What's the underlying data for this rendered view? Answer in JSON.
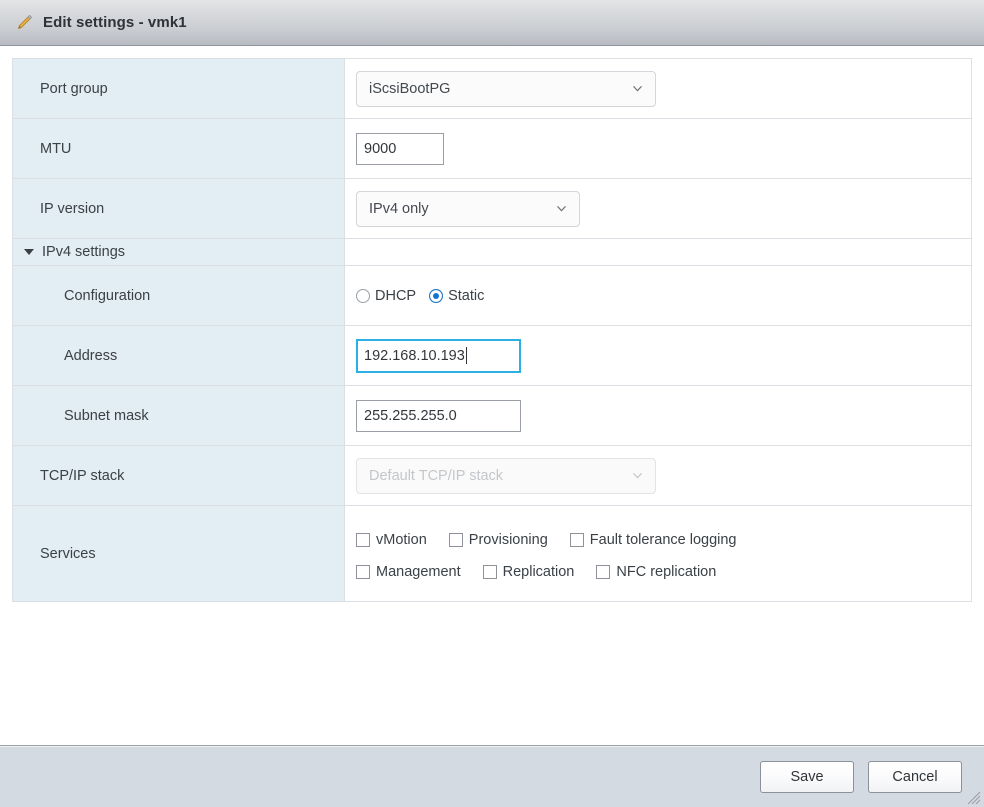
{
  "window": {
    "title": "Edit settings - vmk1",
    "icon": "pencil-icon"
  },
  "form": {
    "rows": [
      {
        "label": "Port group",
        "control": "select",
        "value": "iScsiBootPG"
      },
      {
        "label": "MTU",
        "control": "text",
        "value": "9000"
      },
      {
        "label": "IP version",
        "control": "select",
        "value": "IPv4 only"
      },
      {
        "label": "IPv4 settings",
        "control": "section",
        "expanded": true
      },
      {
        "label": "Configuration",
        "control": "radio"
      },
      {
        "label": "Address",
        "control": "text",
        "value": "192.168.10.193",
        "focused": true
      },
      {
        "label": "Subnet mask",
        "control": "text",
        "value": "255.255.255.0"
      },
      {
        "label": "TCP/IP stack",
        "control": "select",
        "value": "Default TCP/IP stack",
        "disabled": true
      },
      {
        "label": "Services",
        "control": "checkboxes"
      }
    ],
    "labels": {
      "port_group": "Port group",
      "mtu": "MTU",
      "ip_version": "IP version",
      "ipv4_settings": "IPv4 settings",
      "configuration": "Configuration",
      "address": "Address",
      "subnet_mask": "Subnet mask",
      "tcpip_stack": "TCP/IP stack",
      "services": "Services"
    },
    "values": {
      "port_group": "iScsiBootPG",
      "mtu": "9000",
      "ip_version": "IPv4 only",
      "address": "192.168.10.193",
      "subnet_mask": "255.255.255.0",
      "tcpip_stack": "Default TCP/IP stack"
    },
    "configuration": {
      "selected": "Static",
      "options": [
        {
          "label": "DHCP",
          "checked": false
        },
        {
          "label": "Static",
          "checked": true
        }
      ]
    },
    "services": {
      "row1": [
        {
          "label": "vMotion",
          "checked": false
        },
        {
          "label": "Provisioning",
          "checked": false
        },
        {
          "label": "Fault tolerance logging",
          "checked": false
        }
      ],
      "row2": [
        {
          "label": "Management",
          "checked": false
        },
        {
          "label": "Replication",
          "checked": false
        },
        {
          "label": "NFC replication",
          "checked": false
        }
      ]
    }
  },
  "footer": {
    "save_label": "Save",
    "cancel_label": "Cancel"
  },
  "colors": {
    "label_column_bg": "#e3eef4",
    "focus_ring": "#2cafe3",
    "radio_selected": "#1273d4",
    "footer_bg": "#d4dae1",
    "pencil_icon": "#e8a33d"
  }
}
